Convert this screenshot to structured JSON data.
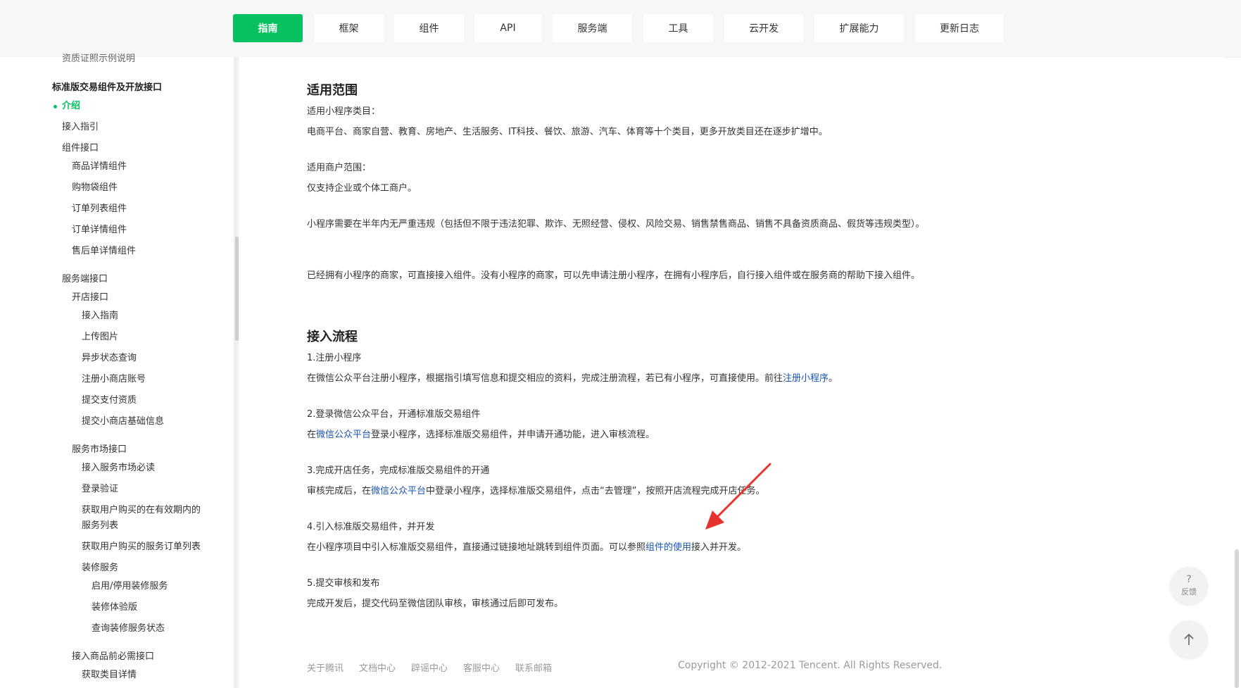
{
  "nav": {
    "tabs": [
      {
        "label": "指南"
      },
      {
        "label": "框架"
      },
      {
        "label": "组件"
      },
      {
        "label": "API"
      },
      {
        "label": "服务端"
      },
      {
        "label": "工具"
      },
      {
        "label": "云开发"
      },
      {
        "label": "扩展能力"
      },
      {
        "label": "更新日志"
      }
    ],
    "active_color": "#07c160"
  },
  "sidebar": {
    "items": [
      "资质证照示例说明",
      "标准版交易组件及开放接口",
      "介绍",
      "接入指引",
      "组件接口",
      "商品详情组件",
      "购物袋组件",
      "订单列表组件",
      "订单详情组件",
      "售后单详情组件",
      "服务端接口",
      "开店接口",
      "接入指南",
      "上传图片",
      "异步状态查询",
      "注册小商店账号",
      "提交支付资质",
      "提交小商店基础信息",
      "服务市场接口",
      "接入服务市场必读",
      "登录验证",
      "获取用户购买的在有效期内的",
      "服务列表",
      "获取用户购买的服务订单列表",
      "装修服务",
      "启用/停用装修服务",
      "装修体验版",
      "查询装修服务状态",
      "接入商品前必需接口",
      "获取类目详情"
    ]
  },
  "main": {
    "scope": {
      "title": "适用范围",
      "category_label": "适用小程序类目：",
      "category_text": "电商平台、商家自营、教育、房地产、生活服务、IT科技、餐饮、旅游、汽车、体育等十个类目，更多开放类目还在逐步扩增中。",
      "merchant_label": "适用商户范围：",
      "merchant_text": "仅支持企业或个体工商户。",
      "violation_text": "小程序需要在半年内无严重违规（包括但不限于违法犯罪、欺诈、无照经营、侵权、风险交易、销售禁售商品、销售不具备资质商品、假货等违规类型）。",
      "owned_text": "已经拥有小程序的商家，可直接接入组件。没有小程序的商家，可以先申请注册小程序，在拥有小程序后，自行接入组件或在服务商的帮助下接入组件。"
    },
    "flow": {
      "title": "接入流程",
      "s1_title": "1.注册小程序",
      "s1_a": "在微信公众平台注册小程序，根据指引填写信息和提交相应的资料，完成注册流程，若已有小程序，可直接使用。前往",
      "s1_link": "注册小程序",
      "s1_b": "。",
      "s2_title": "2.登录微信公众平台，开通标准版交易组件",
      "s2_a": "在",
      "s2_link": "微信公众平台",
      "s2_b": "登录小程序，选择标准版交易组件，并申请开通功能，进入审核流程。",
      "s3_title": "3.完成开店任务，完成标准版交易组件的开通",
      "s3_a": "审核完成后，在",
      "s3_link": "微信公众平台",
      "s3_b": "中登录小程序，选择标准版交易组件，点击“去管理”，按照开店流程完成开店任务。",
      "s4_title": "4.引入标准版交易组件，并开发",
      "s4_a": "在小程序项目中引入标准版交易组件，直接通过链接地址跳转到组件页面。可以参照",
      "s4_link": "组件的使用",
      "s4_b": "接入并开发。",
      "s5_title": "5.提交审核和发布",
      "s5_text": "完成开发后，提交代码至微信团队审核，审核通过后即可发布。"
    }
  },
  "footer": {
    "links": [
      "关于腾讯",
      "文档中心",
      "辟谣中心",
      "客服中心",
      "联系邮箱"
    ],
    "copyright": "Copyright © 2012-2021 Tencent. All Rights Reserved."
  },
  "float": {
    "feedback_mark": "?",
    "feedback_label": "反馈",
    "top_icon": "arrow-up-icon"
  },
  "annotation_color": "#e8312c"
}
